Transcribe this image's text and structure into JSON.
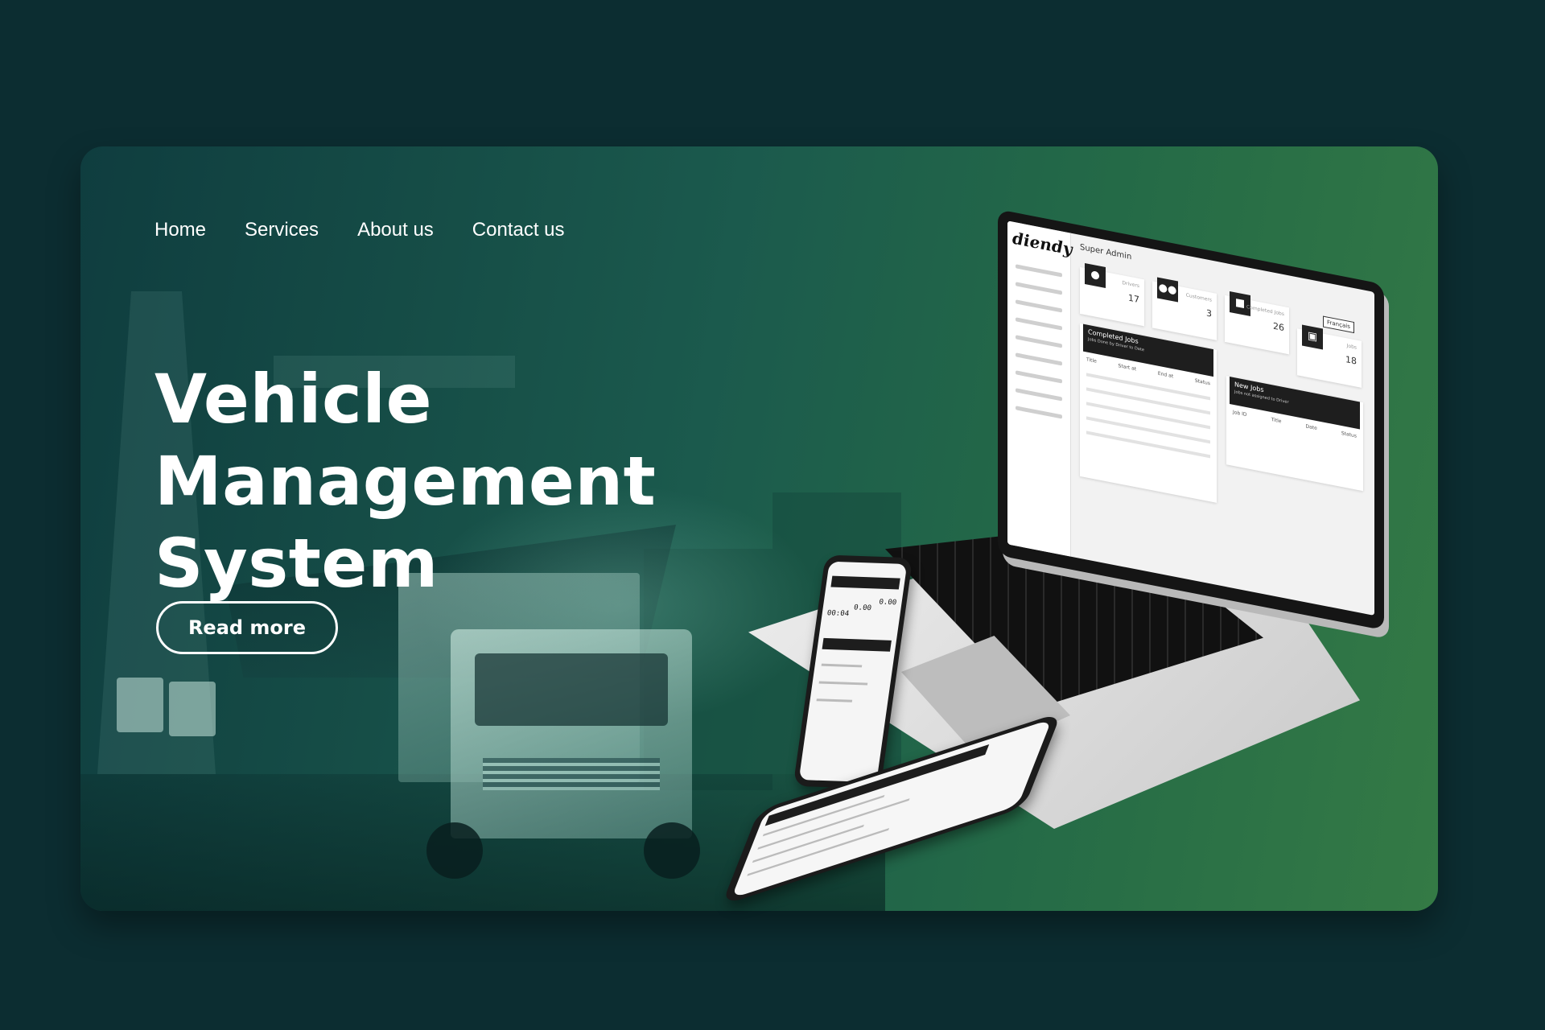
{
  "nav": {
    "items": [
      {
        "label": "Home"
      },
      {
        "label": "Services"
      },
      {
        "label": "About us"
      },
      {
        "label": "Contact us"
      }
    ]
  },
  "hero": {
    "title": "Vehicle Management System",
    "button_label": "Read more"
  },
  "laptop_app": {
    "logo": "diendy",
    "header": "Super Admin",
    "language_button": "Français",
    "stats": [
      {
        "label": "Drivers",
        "value": "17",
        "icon": "user-icon"
      },
      {
        "label": "Customers",
        "value": "3",
        "icon": "users-icon"
      },
      {
        "label": "Completed Jobs",
        "value": "26",
        "icon": "box-icon"
      },
      {
        "label": "Jobs",
        "value": "18",
        "icon": "briefcase-icon"
      }
    ],
    "completed_jobs_panel": {
      "title": "Completed Jobs",
      "subtitle": "Jobs Done by Driver to Date",
      "columns": [
        "Title",
        "Start at",
        "End at",
        "Status"
      ]
    },
    "new_jobs_panel": {
      "title": "New Jobs",
      "subtitle": "Jobs not assigned to Driver",
      "columns": [
        "Job ID",
        "Title",
        "Date",
        "Status"
      ]
    }
  },
  "phone_app": {
    "stats": [
      "00:04",
      "0.00",
      "0.00"
    ]
  },
  "colors": {
    "page_background": "#0c2d31",
    "card_gradient_start": "#0f3d3f",
    "card_gradient_end": "#347a45",
    "text": "#ffffff"
  }
}
